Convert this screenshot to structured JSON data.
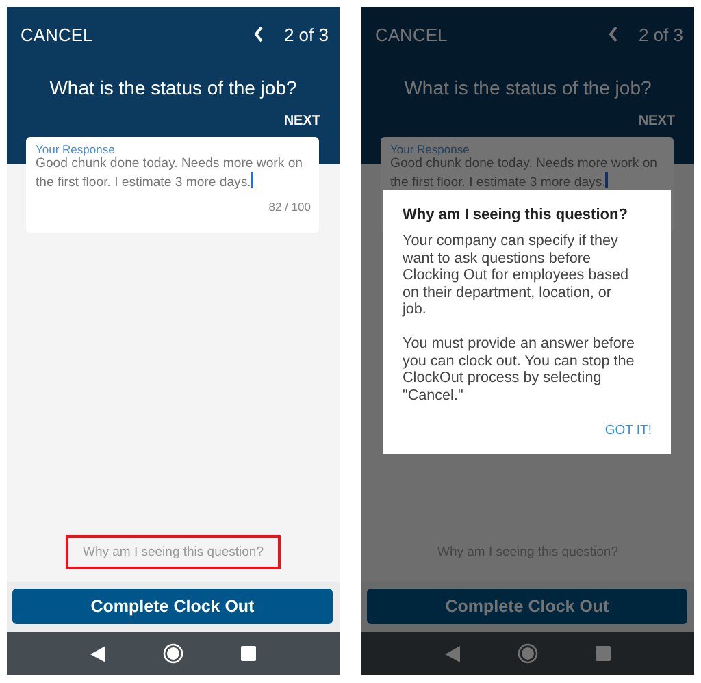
{
  "screens": [
    {
      "dimmed": false,
      "cancel": "CANCEL",
      "position": "2 of 3",
      "question": "What is the status of the job?",
      "next": "NEXT",
      "response": {
        "label": "Your Response",
        "value": "Good chunk done today. Needs more work on the first floor. I estimate 3 more days.",
        "focused": true,
        "counter": "82 / 100"
      },
      "why_link": {
        "text": "Why am I seeing this question?",
        "highlighted": true
      },
      "complete_button": "Complete Clock Out"
    },
    {
      "dimmed": true,
      "cancel": "CANCEL",
      "position": "2 of 3",
      "question": "What is the status of the job?",
      "next": "NEXT",
      "response": {
        "label": "Your Response",
        "value": "Good chunk done today. Needs more work on the first floor. I estimate 3 more days.",
        "focused": true
      },
      "why_link": {
        "text": "Why am I seeing this question?",
        "highlighted": false
      },
      "complete_button": "Complete Clock Out",
      "dialog": {
        "title": "Why am I seeing this question?",
        "paragraphs": [
          "Your company can specify if they want to ask questions before Clocking Out for employees based on their department, location, or job.",
          "You must provide an answer before you can clock out. You can stop the ClockOut process by selecting \"Cancel.\""
        ],
        "button": "GOT IT!"
      }
    }
  ]
}
